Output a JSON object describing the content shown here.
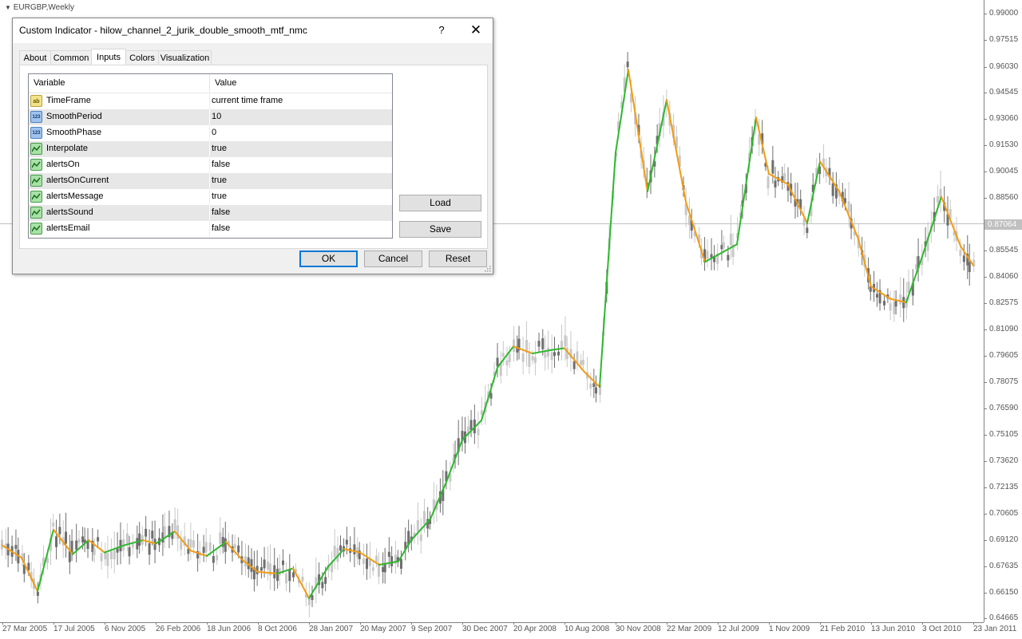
{
  "chart": {
    "symbol": "EURGBP,Weekly",
    "current_price": "0.87064",
    "price_ticks": [
      "0.99000",
      "0.97515",
      "0.96030",
      "0.94545",
      "0.93060",
      "0.91530",
      "0.90045",
      "0.88560",
      "0.87064",
      "0.85545",
      "0.84060",
      "0.82575",
      "0.81090",
      "0.79605",
      "0.78075",
      "0.76590",
      "0.75105",
      "0.73620",
      "0.72135",
      "0.70605",
      "0.69120",
      "0.67635",
      "0.66150",
      "0.64665"
    ],
    "time_ticks": [
      "27 Mar 2005",
      "17 Jul 2005",
      "6 Nov 2005",
      "26 Feb 2006",
      "18 Jun 2006",
      "8 Oct 2006",
      "28 Jan 2007",
      "20 May 2007",
      "9 Sep 2007",
      "30 Dec 2007",
      "20 Apr 2008",
      "10 Aug 2008",
      "30 Nov 2008",
      "22 Mar 2009",
      "12 Jul 2009",
      "1 Nov 2009",
      "21 Feb 2010",
      "13 Jun 2010",
      "3 Oct 2010",
      "23 Jan 2011"
    ],
    "colors": {
      "up_line": "#2eb82e",
      "down_line": "#f39c12",
      "bull_candle": "#c8c8c8",
      "bear_candle": "#6e6e6e"
    },
    "ylim": [
      0.64665,
      0.99
    ]
  },
  "chart_data": {
    "type": "line",
    "title": "",
    "xlabel": "",
    "ylabel": "",
    "ylim": [
      0.64665,
      0.99
    ],
    "series": [
      {
        "values": [
          [
            "2005-03-27",
            0.688
          ],
          [
            "2005-05-08",
            0.681
          ],
          [
            "2005-06-12",
            0.662
          ],
          [
            "2005-07-17",
            0.697
          ],
          [
            "2005-08-28",
            0.683
          ],
          [
            "2005-10-02",
            0.691
          ],
          [
            "2005-11-06",
            0.684
          ],
          [
            "2005-12-18",
            0.688
          ],
          [
            "2006-01-29",
            0.691
          ],
          [
            "2006-02-26",
            0.689
          ],
          [
            "2006-04-09",
            0.696
          ],
          [
            "2006-05-14",
            0.685
          ],
          [
            "2006-06-18",
            0.682
          ],
          [
            "2006-07-30",
            0.69
          ],
          [
            "2006-09-03",
            0.68
          ],
          [
            "2006-10-08",
            0.673
          ],
          [
            "2006-11-19",
            0.672
          ],
          [
            "2006-12-24",
            0.675
          ],
          [
            "2007-01-28",
            0.658
          ],
          [
            "2007-03-11",
            0.676
          ],
          [
            "2007-04-15",
            0.686
          ],
          [
            "2007-05-20",
            0.684
          ],
          [
            "2007-07-01",
            0.677
          ],
          [
            "2007-08-12",
            0.679
          ],
          [
            "2007-09-09",
            0.691
          ],
          [
            "2007-10-21",
            0.703
          ],
          [
            "2007-11-25",
            0.724
          ],
          [
            "2007-12-30",
            0.748
          ],
          [
            "2008-02-10",
            0.759
          ],
          [
            "2008-03-16",
            0.789
          ],
          [
            "2008-04-20",
            0.801
          ],
          [
            "2008-06-01",
            0.797
          ],
          [
            "2008-07-13",
            0.799
          ],
          [
            "2008-08-10",
            0.8
          ],
          [
            "2008-09-21",
            0.787
          ],
          [
            "2008-10-26",
            0.778
          ],
          [
            "2008-11-30",
            0.911
          ],
          [
            "2008-12-28",
            0.958
          ],
          [
            "2009-02-08",
            0.889
          ],
          [
            "2009-03-22",
            0.941
          ],
          [
            "2009-05-03",
            0.883
          ],
          [
            "2009-06-14",
            0.849
          ],
          [
            "2009-07-12",
            0.853
          ],
          [
            "2009-08-23",
            0.859
          ],
          [
            "2009-10-04",
            0.931
          ],
          [
            "2009-11-01",
            0.899
          ],
          [
            "2009-12-13",
            0.893
          ],
          [
            "2010-01-24",
            0.871
          ],
          [
            "2010-02-21",
            0.906
          ],
          [
            "2010-04-04",
            0.889
          ],
          [
            "2010-05-16",
            0.862
          ],
          [
            "2010-06-13",
            0.835
          ],
          [
            "2010-07-25",
            0.828
          ],
          [
            "2010-08-29",
            0.826
          ],
          [
            "2010-10-03",
            0.852
          ],
          [
            "2010-11-14",
            0.886
          ],
          [
            "2010-12-26",
            0.858
          ],
          [
            "2011-01-23",
            0.847
          ]
        ]
      }
    ]
  },
  "dialog": {
    "title": "Custom Indicator - hilow_channel_2_jurik_double_smooth_mtf_nmc",
    "help": "?",
    "close": "✕",
    "tabs": [
      "About",
      "Common",
      "Inputs",
      "Colors",
      "Visualization"
    ],
    "active_tab": "Inputs",
    "columns": {
      "variable": "Variable",
      "value": "Value"
    },
    "rows": [
      {
        "type": "str",
        "icon": "ab",
        "name": "TimeFrame",
        "value": "current time frame"
      },
      {
        "type": "num",
        "icon": "123",
        "name": "SmoothPeriod",
        "value": "10"
      },
      {
        "type": "num",
        "icon": "123",
        "name": "SmoothPhase",
        "value": "0"
      },
      {
        "type": "bool",
        "icon": "bool",
        "name": "Interpolate",
        "value": "true"
      },
      {
        "type": "bool",
        "icon": "bool",
        "name": "alertsOn",
        "value": "false"
      },
      {
        "type": "bool",
        "icon": "bool",
        "name": "alertsOnCurrent",
        "value": "true"
      },
      {
        "type": "bool",
        "icon": "bool",
        "name": "alertsMessage",
        "value": "true"
      },
      {
        "type": "bool",
        "icon": "bool",
        "name": "alertsSound",
        "value": "false"
      },
      {
        "type": "bool",
        "icon": "bool",
        "name": "alertsEmail",
        "value": "false"
      }
    ],
    "buttons": {
      "load": "Load",
      "save": "Save",
      "ok": "OK",
      "cancel": "Cancel",
      "reset": "Reset"
    }
  }
}
